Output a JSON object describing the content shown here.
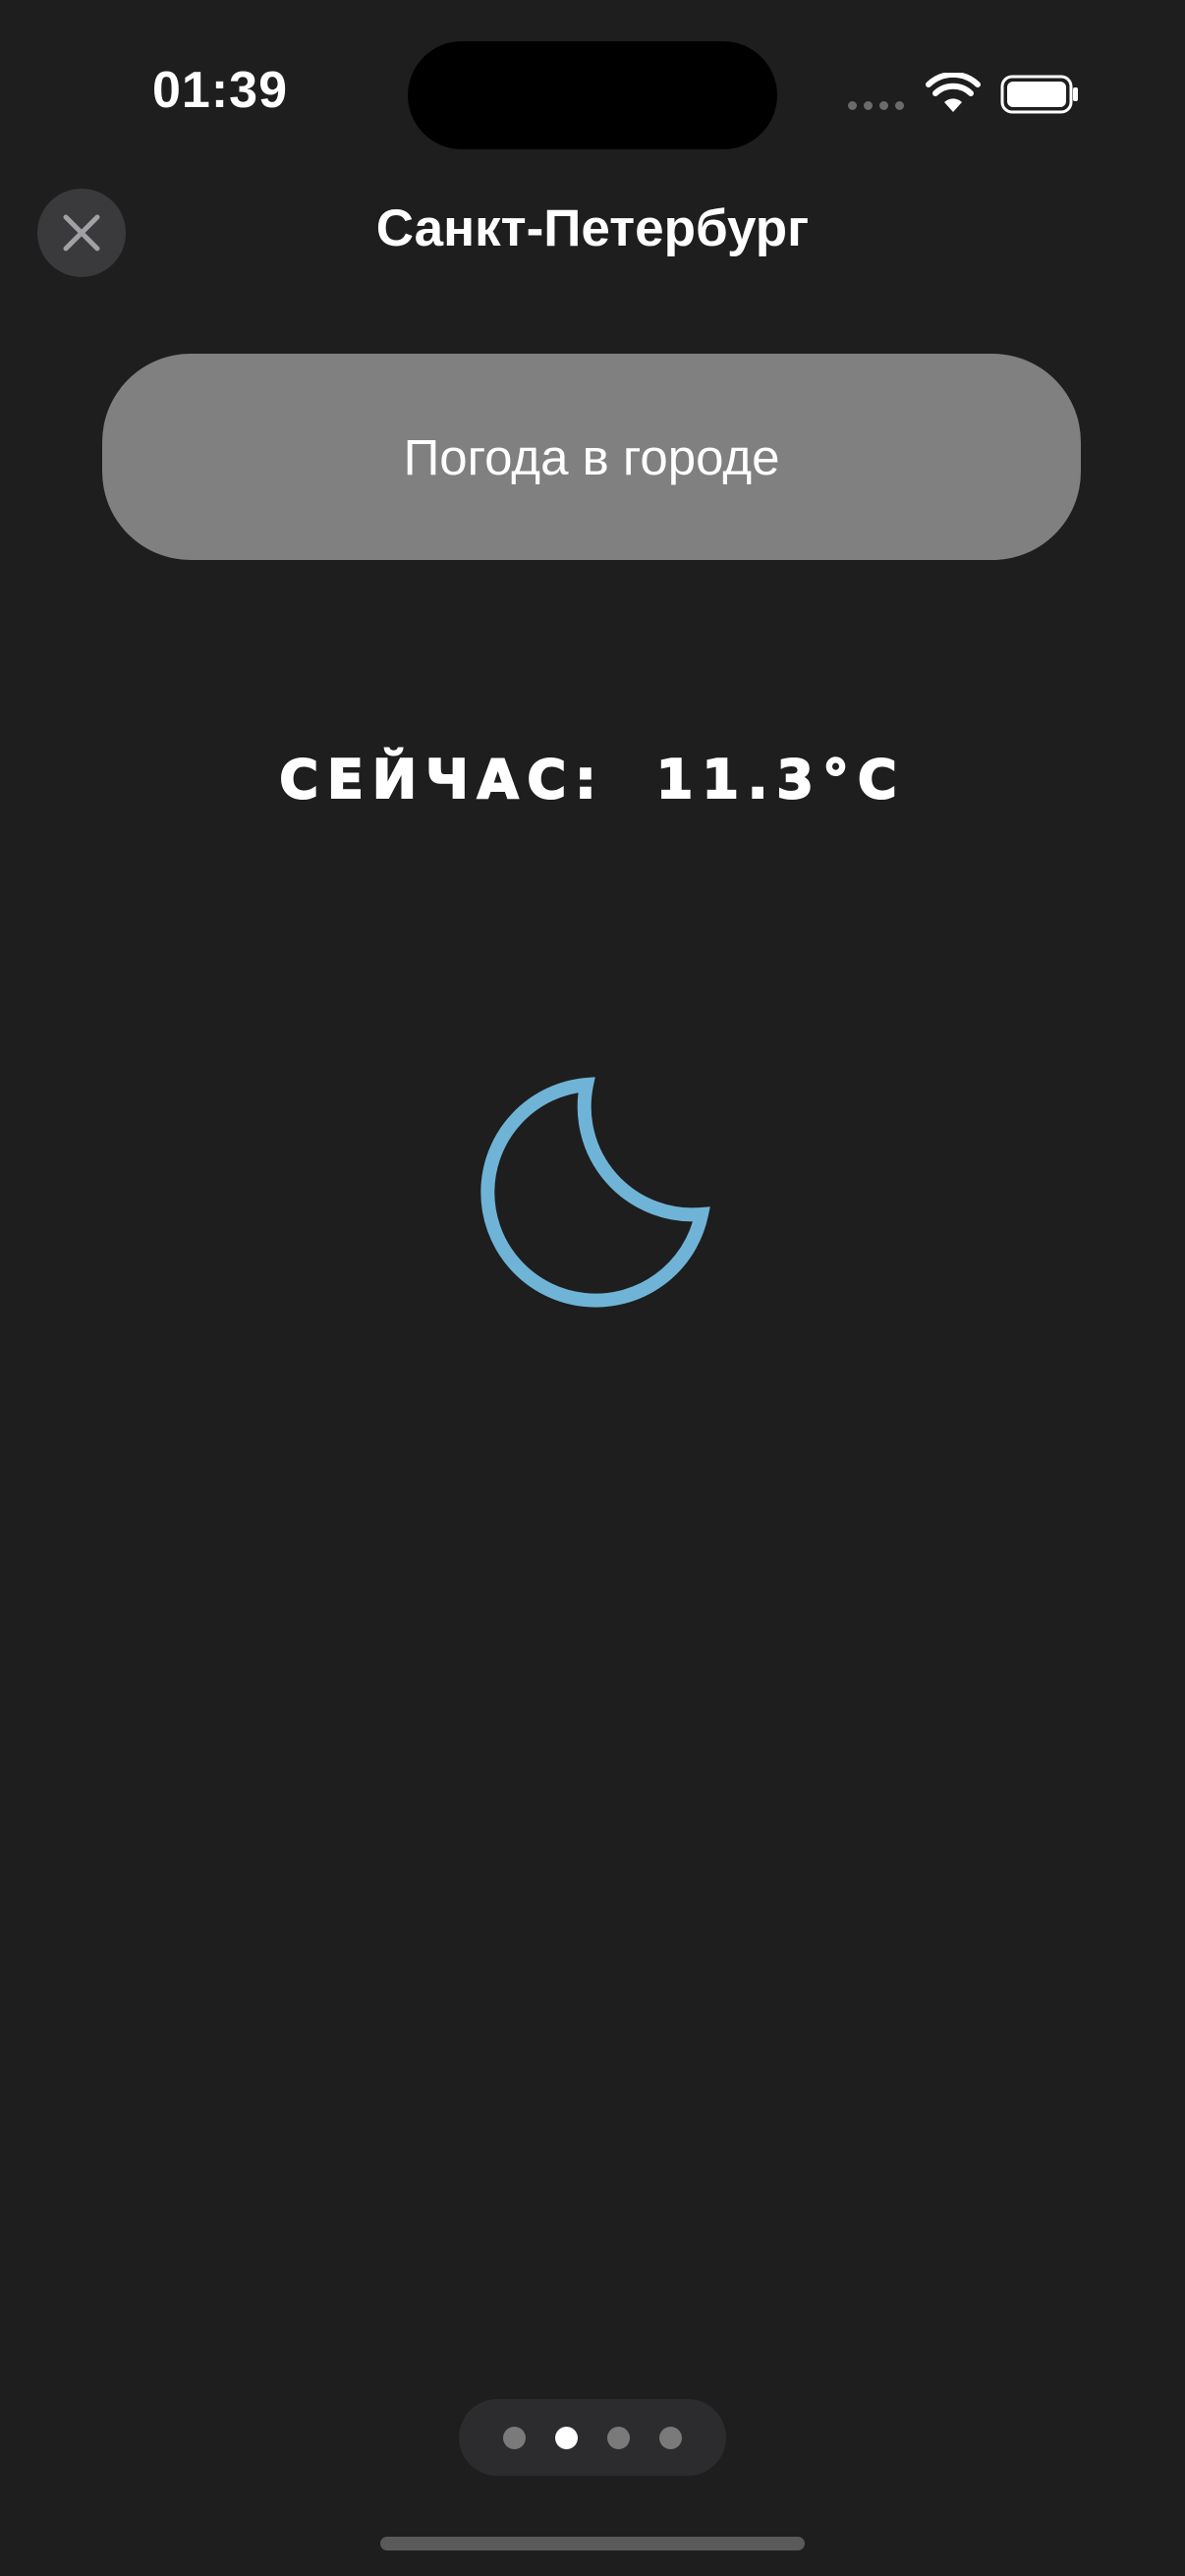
{
  "status_bar": {
    "time": "01:39",
    "icons": [
      "cellular-signal-icon",
      "wifi-icon",
      "battery-icon"
    ]
  },
  "nav": {
    "title": "Санкт-Петербург",
    "close_icon": "close-icon"
  },
  "weather_button": {
    "label": "Погода в городе"
  },
  "current": {
    "label": "СЕЙЧАС:",
    "temperature": "11.3°C",
    "condition_icon": "moon-icon"
  },
  "pagination": {
    "pages": 4,
    "active_index": 1
  },
  "colors": {
    "background": "#1e1e1e",
    "button": "#808080",
    "moon": "#6fb4d6",
    "close_button": "#3a3a3c"
  }
}
